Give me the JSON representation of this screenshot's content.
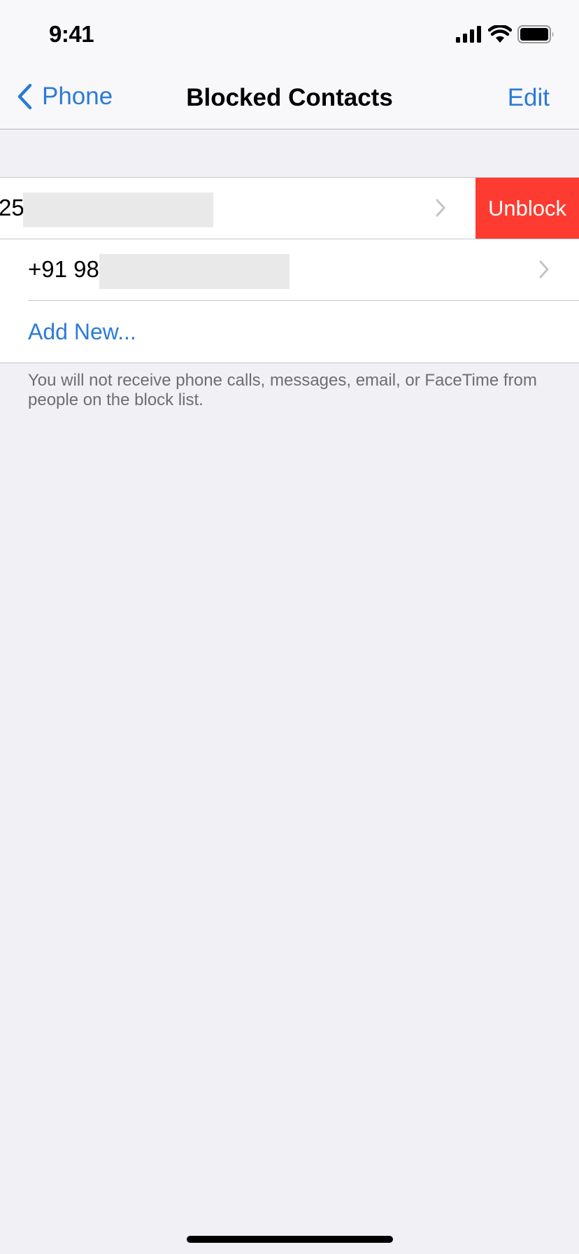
{
  "status_bar": {
    "time": "9:41",
    "icons": [
      "cellular-signal-icon",
      "wifi-icon",
      "battery-icon"
    ]
  },
  "navbar": {
    "back_label": "Phone",
    "title": "Blocked Contacts",
    "edit_label": "Edit"
  },
  "blocked_list": {
    "items": [
      {
        "number_visible": "25",
        "redacted": true,
        "swiped": true,
        "action_label": "Unblock"
      },
      {
        "number_visible": "+91 98",
        "redacted": true,
        "swiped": false
      }
    ],
    "add_new_label": "Add New..."
  },
  "footer_note": "You will not receive phone calls, messages, email, or FaceTime from people on the block list.",
  "colors": {
    "accent": "#2b7bd8",
    "destructive": "#fe3b30",
    "background": "#f0f0f5"
  }
}
